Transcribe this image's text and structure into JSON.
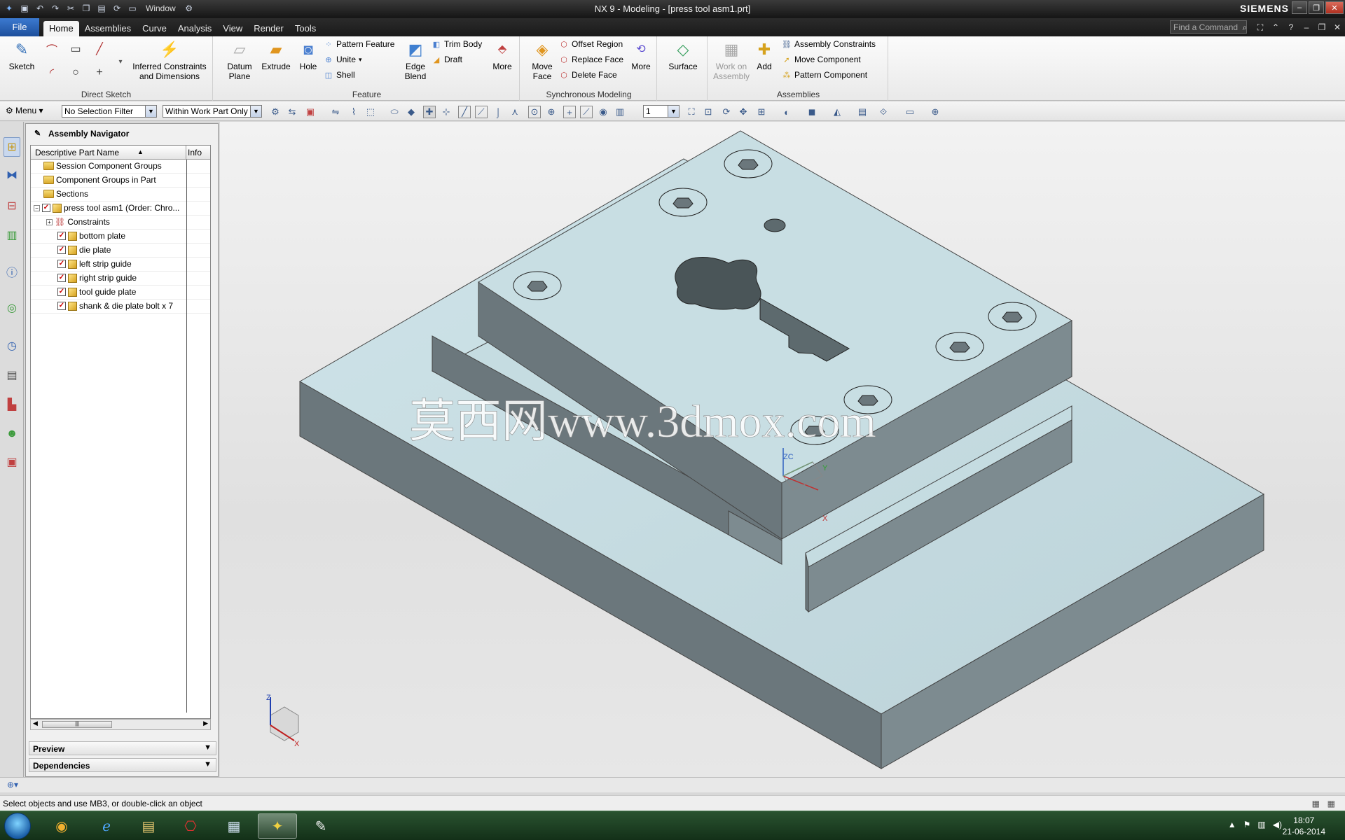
{
  "window": {
    "title": "NX 9 - Modeling - [press tool asm1.prt]",
    "brand": "SIEMENS",
    "window_menu": "Window"
  },
  "tabs": {
    "file": "File",
    "items": [
      "Home",
      "Assemblies",
      "Curve",
      "Analysis",
      "View",
      "Render",
      "Tools"
    ],
    "active": "Home",
    "find_placeholder": "Find a Command"
  },
  "ribbon": {
    "direct_sketch": {
      "sketch": "Sketch",
      "inferred": "Inferred Constraints and Dimensions",
      "label": "Direct Sketch"
    },
    "feature": {
      "datum_plane": "Datum Plane",
      "extrude": "Extrude",
      "hole": "Hole",
      "pattern_feature": "Pattern Feature",
      "unite": "Unite",
      "shell": "Shell",
      "edge_blend": "Edge Blend",
      "trim_body": "Trim Body",
      "draft": "Draft",
      "more": "More",
      "label": "Feature"
    },
    "sync": {
      "move_face": "Move Face",
      "offset_region": "Offset Region",
      "replace_face": "Replace Face",
      "delete_face": "Delete Face",
      "more": "More",
      "label": "Synchronous Modeling"
    },
    "surface": "Surface",
    "assemblies": {
      "work_on_assembly": "Work on Assembly",
      "add": "Add",
      "assembly_constraints": "Assembly Constraints",
      "move_component": "Move Component",
      "pattern_component": "Pattern Component",
      "label": "Assemblies"
    }
  },
  "selection_bar": {
    "menu": "Menu",
    "filter": "No Selection Filter",
    "scope": "Within Work Part Only",
    "layer": "1"
  },
  "navigator": {
    "title": "Assembly Navigator",
    "col_name": "Descriptive Part Name",
    "col_info": "Info",
    "rows": [
      {
        "label": "Session Component Groups",
        "type": "folder"
      },
      {
        "label": "Component Groups in Part",
        "type": "folder"
      },
      {
        "label": "Sections",
        "type": "folder"
      },
      {
        "label": "press tool asm1 (Order: Chro...",
        "type": "assembly"
      },
      {
        "label": "Constraints",
        "type": "constraints"
      },
      {
        "label": "bottom plate",
        "type": "part"
      },
      {
        "label": "die plate",
        "type": "part"
      },
      {
        "label": "left strip guide",
        "type": "part"
      },
      {
        "label": "right strip guide",
        "type": "part"
      },
      {
        "label": "tool guide plate",
        "type": "part"
      },
      {
        "label": "shank & die plate bolt x 7",
        "type": "part"
      }
    ],
    "preview": "Preview",
    "dependencies": "Dependencies"
  },
  "viewport": {
    "watermark": "莫西网www.3dmox.com",
    "csys": {
      "x": "X",
      "y": "Y",
      "z": "ZC",
      "triad_z": "Z",
      "triad_x": "X"
    }
  },
  "status": {
    "cue": "Select objects and use MB3, or double-click an object"
  },
  "taskbar": {
    "time": "18:07",
    "date": "21-06-2014"
  },
  "colors": {
    "accent": "#1d4f9c",
    "model_top": "#c6dde2",
    "model_side": "#6b7b80"
  }
}
